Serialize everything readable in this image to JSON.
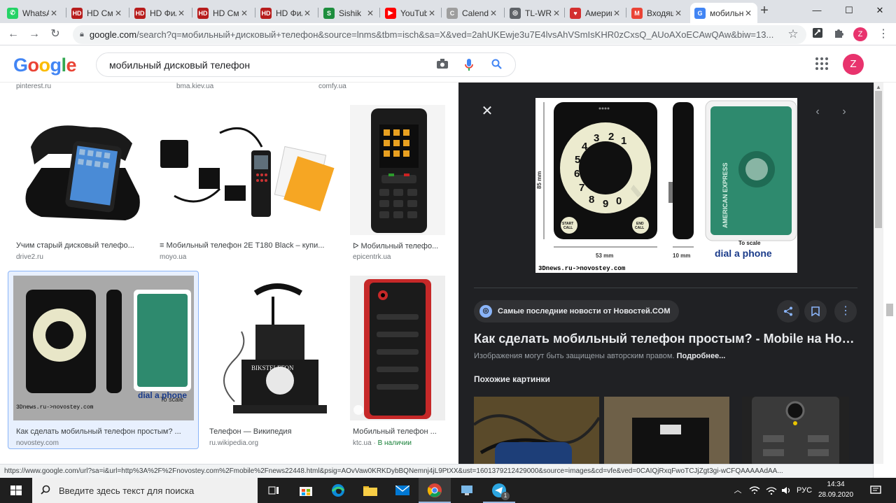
{
  "browser": {
    "tabs": [
      {
        "title": "WhatsApp",
        "favicon": "whatsapp-icon",
        "color": "#25d366",
        "glyph": "✆"
      },
      {
        "title": "HD Смотреть",
        "favicon": "hd-icon",
        "color": "#b71c1c",
        "glyph": "HD"
      },
      {
        "title": "HD Фильмы",
        "favicon": "hd-icon",
        "color": "#b71c1c",
        "glyph": "HD"
      },
      {
        "title": "HD Смотреть",
        "favicon": "hd-icon",
        "color": "#b71c1c",
        "glyph": "HD"
      },
      {
        "title": "HD Фильмы",
        "favicon": "hd-icon",
        "color": "#b71c1c",
        "glyph": "HD"
      },
      {
        "title": "Sishik",
        "favicon": "bookmark-icon",
        "color": "#1e8e3e",
        "glyph": "S"
      },
      {
        "title": "YouTube",
        "favicon": "youtube-icon",
        "color": "#ff0000",
        "glyph": "▶"
      },
      {
        "title": "Calendar",
        "favicon": "calendar-icon",
        "color": "#9e9e9e",
        "glyph": "C"
      },
      {
        "title": "TL-WR",
        "favicon": "globe-icon",
        "color": "#5f6368",
        "glyph": "◎"
      },
      {
        "title": "Америка",
        "favicon": "lips-icon",
        "color": "#d32f2f",
        "glyph": "♥"
      },
      {
        "title": "Входящие",
        "favicon": "gmail-icon",
        "color": "#ea4335",
        "glyph": "M"
      },
      {
        "title": "мобильный",
        "favicon": "google-icon",
        "color": "#4285f4",
        "glyph": "G"
      }
    ],
    "active_tab": 11,
    "new_tab": "+",
    "window": {
      "minimize": "—",
      "maximize": "☐",
      "close": "✕"
    },
    "toolbar": {
      "back": "←",
      "forward": "→",
      "reload": "↻",
      "url_host": "google.com",
      "url_rest": "/search?q=мобильный+дисковый+телефон&source=lnms&tbm=isch&sa=X&ved=2ahUKEwje3u7E4lvsAhVSmIsKHR0zCxsQ_AUoAXoECAwQAw&biw=13...",
      "star": "☆",
      "profile_initial": "Z",
      "profile_color": "#e8336d"
    }
  },
  "google": {
    "logo_letters": [
      {
        "ch": "G",
        "color": "#4285f4"
      },
      {
        "ch": "o",
        "color": "#ea4335"
      },
      {
        "ch": "o",
        "color": "#fbbc05"
      },
      {
        "ch": "g",
        "color": "#4285f4"
      },
      {
        "ch": "l",
        "color": "#34a853"
      },
      {
        "ch": "e",
        "color": "#ea4335"
      }
    ],
    "query": "мобильный дисковый телефон",
    "profile_initial": "Z"
  },
  "results": {
    "top_sources": [
      "pinterest.ru",
      "bma.kiev.ua",
      "comfy.ua"
    ],
    "items": [
      {
        "title": "Учим старый дисковый телефо...",
        "source": "drive2.ru",
        "thumb": "dial-phone-dock"
      },
      {
        "title": "≡ Мобильный телефон 2E T180 Black – купи...",
        "source": "moyo.ua",
        "thumb": "phone-accessories"
      },
      {
        "title": "ᐅ Мобильный телефо...",
        "source": "epicentrk.ua",
        "thumb": "rugged-phone"
      },
      {
        "title": "Как сделать мобильный телефон простым? ...",
        "source": "novostey.com",
        "thumb": "dial-card-phone"
      },
      {
        "title": "Телефон — Википедия",
        "source": "ru.wikipedia.org",
        "thumb": "antique-phone"
      },
      {
        "title": "Мобильный телефон ...",
        "source": "ktc.ua",
        "stock": "В наличии",
        "thumb": "red-rugged-phone"
      }
    ],
    "selected_index": 3
  },
  "preview": {
    "source_name": "Самые последние новости от Новостей.COM",
    "title": "Как сделать мобильный телефон простым? - Mobile на Ново...",
    "copyright_note": "Изображения могут быть защищены авторским правом.",
    "more_link": "Подробнее...",
    "related_heading": "Похожие картинки",
    "image": {
      "dial_digits": [
        "1",
        "2",
        "3",
        "4",
        "5",
        "6",
        "7",
        "8",
        "9",
        "0"
      ],
      "start_label": "START CALL",
      "end_label": "END CALL",
      "height_label": "85 mm",
      "width_label": "53 mm",
      "depth_label": "10 mm",
      "brand_line1": "To scale",
      "brand_line2": "dial a phone",
      "card_text": "AMERICAN EXPRESS",
      "watermark": "3Dnews.ru->novostey.com"
    }
  },
  "status_url": "https://www.google.com/url?sa=i&url=http%3A%2F%2Fnovostey.com%2Fmobile%2Fnews22448.html&psig=AOvVaw0KRKDybBQNemnj4jL9PtXX&ust=1601379212429000&source=images&cd=vfe&ved=0CAIQjRxqFwoTCJjZgt3gi-wCFQAAAAAdAA...",
  "taskbar": {
    "search_placeholder": "Введите здесь текст для поиска",
    "lang": "РУС",
    "time": "14:34",
    "date": "28.09.2020",
    "telegram_badge": "1"
  }
}
